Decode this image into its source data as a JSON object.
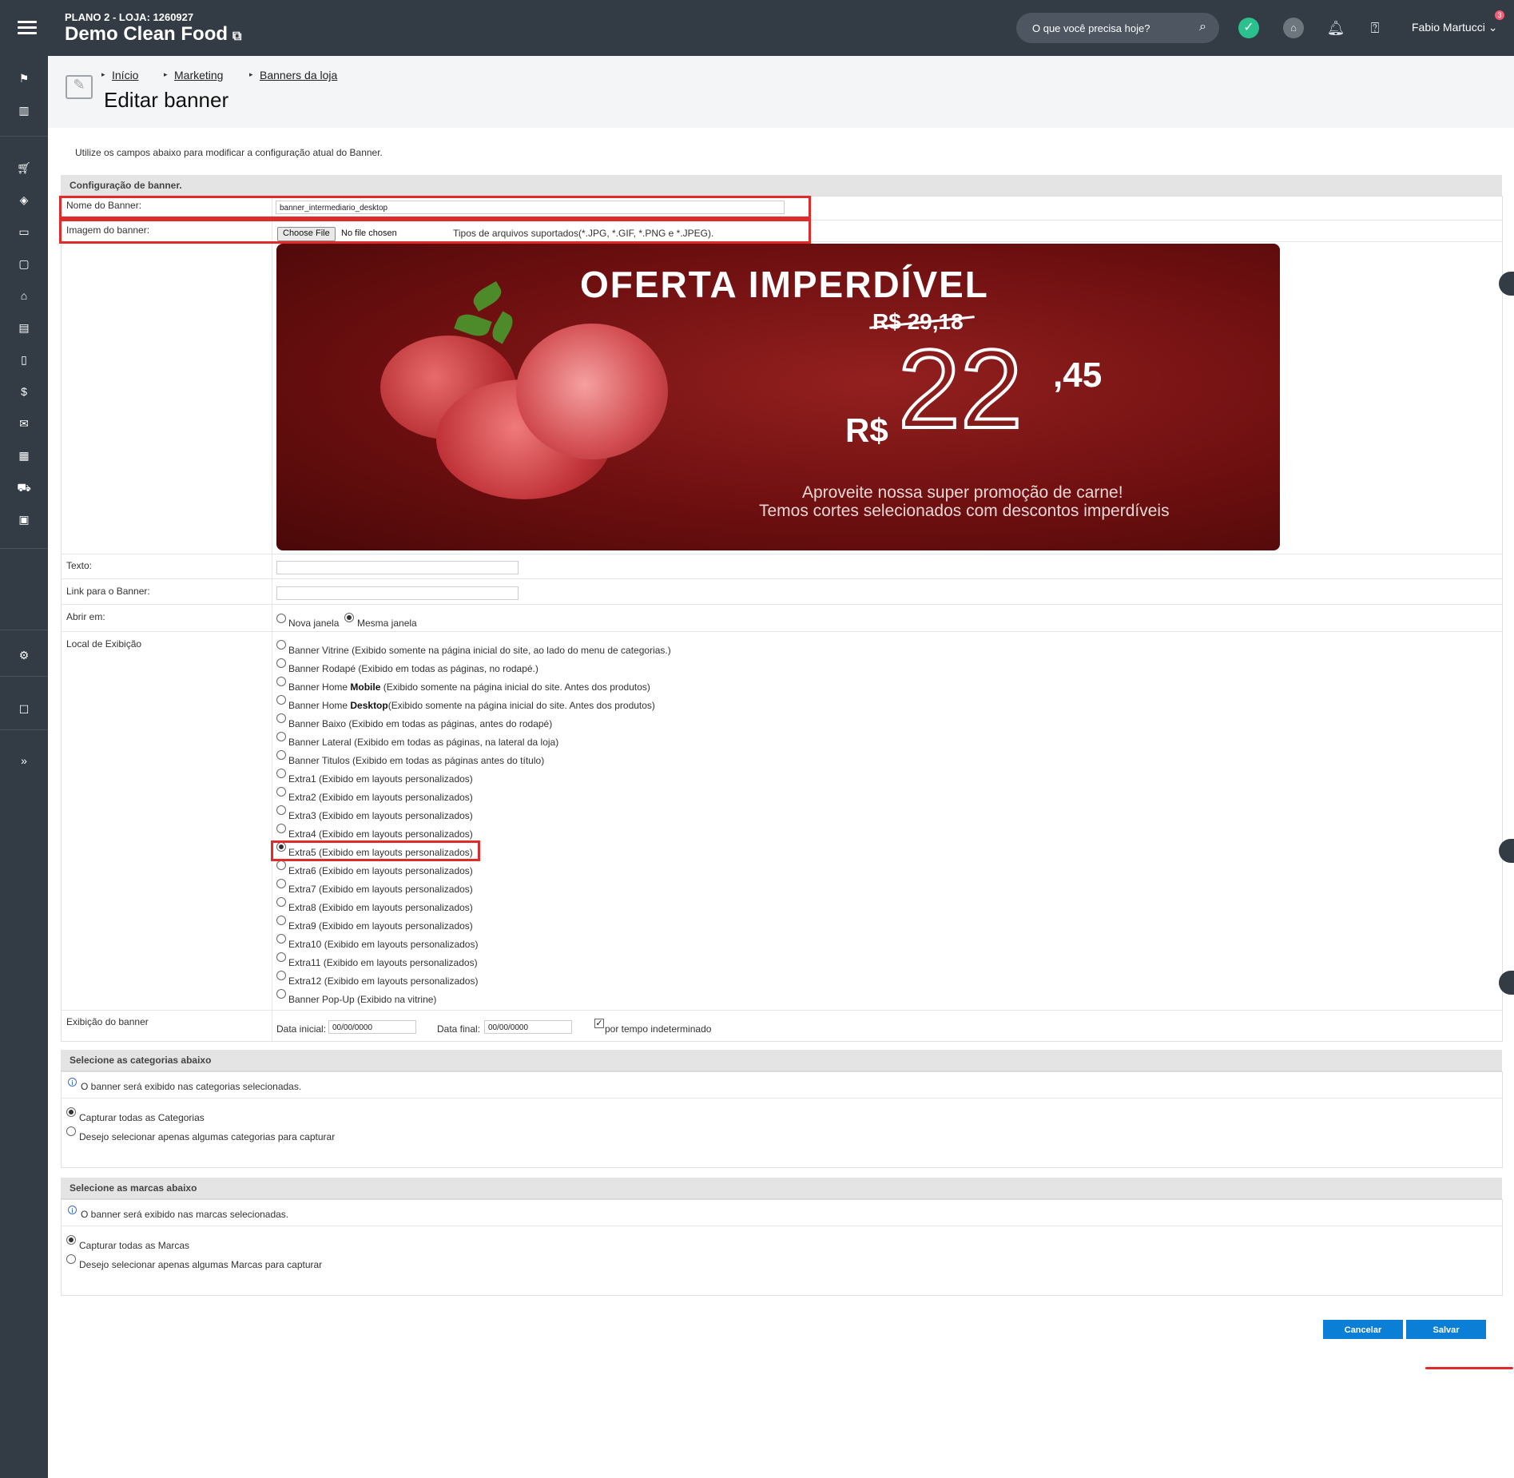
{
  "topbar": {
    "store_plan": "PLANO 2 - LOJA: 1260927",
    "store_name": "Demo Clean Food",
    "search_placeholder": "O que você precisa hoje?",
    "user_name": "Fabio Martucci",
    "notification_count": "3"
  },
  "breadcrumb": [
    "Início",
    "Marketing",
    "Banners da loja"
  ],
  "page_title": "Editar banner",
  "intro_text": "Utilize os campos abaixo para modificar a configuração atual do Banner.",
  "config_section": {
    "heading": "Configuração de banner.",
    "name_label": "Nome do Banner:",
    "name_value": "banner_intermediario_desktop",
    "image_label": "Imagem do banner:",
    "file_button": "Choose File",
    "file_status": "No file chosen",
    "file_types": "Tipos de arquivos suportados(*.JPG, *.GIF, *.PNG e *.JPEG).",
    "banner_image": {
      "title": "OFERTA IMPERDÍVEL",
      "old_price": "R$ 29,18",
      "currency": "R$",
      "price_int": "22",
      "price_cents": ",45",
      "line1": "Aproveite nossa super promoção de carne!",
      "line2": "Temos cortes selecionados com descontos imperdíveis"
    },
    "text_label": "Texto:",
    "text_value": "",
    "link_label": "Link para o Banner:",
    "link_value": "",
    "open_label": "Abrir em:",
    "open_options": [
      "Nova janela",
      "Mesma janela"
    ],
    "open_selected": "Mesma janela",
    "location_label": "Local de Exibição",
    "locations": [
      {
        "pre": "Banner Vitrine",
        "bold": "",
        "post": " (Exibido somente na página inicial do site, ao lado do menu de categorias.)"
      },
      {
        "pre": "Banner Rodapé",
        "bold": "",
        "post": " (Exibido em todas as páginas, no rodapé.)"
      },
      {
        "pre": "Banner Home ",
        "bold": "Mobile",
        "post": " (Exibido somente na página inicial do site. Antes dos produtos)"
      },
      {
        "pre": "Banner Home ",
        "bold": "Desktop",
        "post": "(Exibido somente na página inicial do site. Antes dos produtos)"
      },
      {
        "pre": "Banner Baixo",
        "bold": "",
        "post": " (Exibido em todas as páginas, antes do rodapé)"
      },
      {
        "pre": "Banner Lateral",
        "bold": "",
        "post": " (Exibido em todas as páginas, na lateral da loja)"
      },
      {
        "pre": "Banner Titulos",
        "bold": "",
        "post": " (Exibido em todas as páginas antes do título)"
      },
      {
        "pre": "Extra1",
        "bold": "",
        "post": " (Exibido em layouts personalizados)"
      },
      {
        "pre": "Extra2",
        "bold": "",
        "post": " (Exibido em layouts personalizados)"
      },
      {
        "pre": "Extra3",
        "bold": "",
        "post": " (Exibido em layouts personalizados)"
      },
      {
        "pre": "Extra4",
        "bold": "",
        "post": " (Exibido em layouts personalizados)"
      },
      {
        "pre": "Extra5",
        "bold": "",
        "post": " (Exibido em layouts personalizados)"
      },
      {
        "pre": "Extra6",
        "bold": "",
        "post": " (Exibido em layouts personalizados)"
      },
      {
        "pre": "Extra7",
        "bold": "",
        "post": " (Exibido em layouts personalizados)"
      },
      {
        "pre": "Extra8",
        "bold": "",
        "post": " (Exibido em layouts personalizados)"
      },
      {
        "pre": "Extra9",
        "bold": "",
        "post": " (Exibido em layouts personalizados)"
      },
      {
        "pre": "Extra10",
        "bold": "",
        "post": " (Exibido em layouts personalizados)"
      },
      {
        "pre": "Extra11",
        "bold": "",
        "post": " (Exibido em layouts personalizados)"
      },
      {
        "pre": "Extra12",
        "bold": "",
        "post": " (Exibido em layouts personalizados)"
      },
      {
        "pre": "Banner Pop-Up",
        "bold": "",
        "post": " (Exibido na vitrine)"
      }
    ],
    "location_selected_index": 11,
    "display_label": "Exibição do banner",
    "start_label": "Data inicial:",
    "start_value": "00/00/0000",
    "end_label": "Data final:",
    "end_value": "00/00/0000",
    "indefinite_label": "por tempo indeterminado",
    "indefinite_checked": true
  },
  "categories_section": {
    "heading": "Selecione as categorias abaixo",
    "info": "O banner será exibido nas categorias selecionadas.",
    "options": [
      "Capturar todas as Categorias",
      "Desejo selecionar apenas algumas categorias para capturar"
    ],
    "selected_index": 0
  },
  "brands_section": {
    "heading": "Selecione as marcas abaixo",
    "info": "O banner será exibido nas marcas selecionadas.",
    "options": [
      "Capturar todas as Marcas",
      "Desejo selecionar apenas algumas Marcas para capturar"
    ],
    "selected_index": 0
  },
  "buttons": {
    "cancel": "Cancelar",
    "save": "Salvar"
  },
  "colors": {
    "sidebar": "#333b44",
    "primary_button": "#0b7fd6",
    "highlight": "#e02b2b",
    "success": "#2bc08d"
  }
}
